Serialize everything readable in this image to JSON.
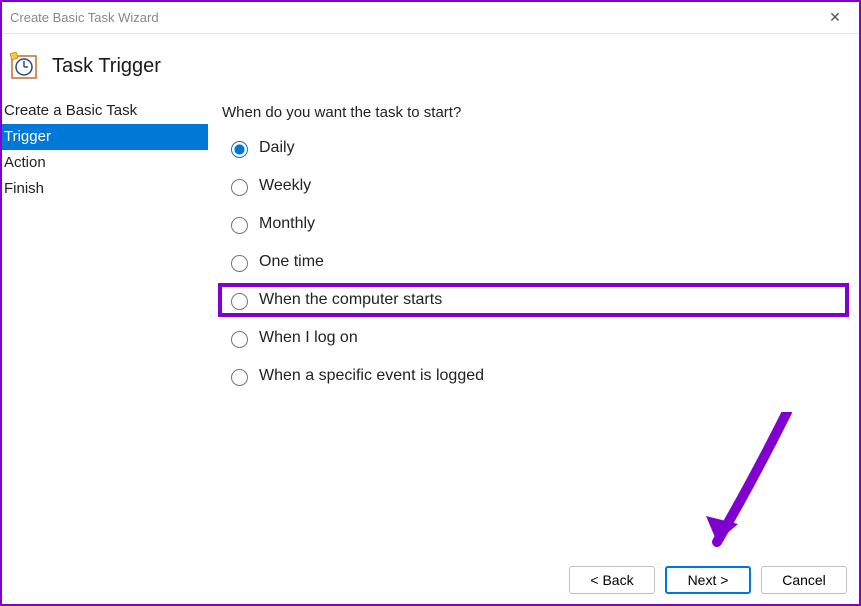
{
  "window": {
    "title": "Create Basic Task Wizard",
    "close": "✕"
  },
  "header": {
    "title": "Task Trigger"
  },
  "sidebar": {
    "steps": [
      {
        "label": "Create a Basic Task"
      },
      {
        "label": "Trigger"
      },
      {
        "label": "Action"
      },
      {
        "label": "Finish"
      }
    ],
    "active_index": 1
  },
  "content": {
    "question": "When do you want the task to start?",
    "options": [
      {
        "label": "Daily"
      },
      {
        "label": "Weekly"
      },
      {
        "label": "Monthly"
      },
      {
        "label": "One time"
      },
      {
        "label": "When the computer starts"
      },
      {
        "label": "When I log on"
      },
      {
        "label": "When a specific event is logged"
      }
    ],
    "selected_index": 0,
    "highlighted_index": 4
  },
  "buttons": {
    "back": "< Back",
    "next": "Next >",
    "cancel": "Cancel"
  },
  "annotations": {
    "arrow_color": "#8000d0",
    "highlight_color": "#8000d0"
  }
}
